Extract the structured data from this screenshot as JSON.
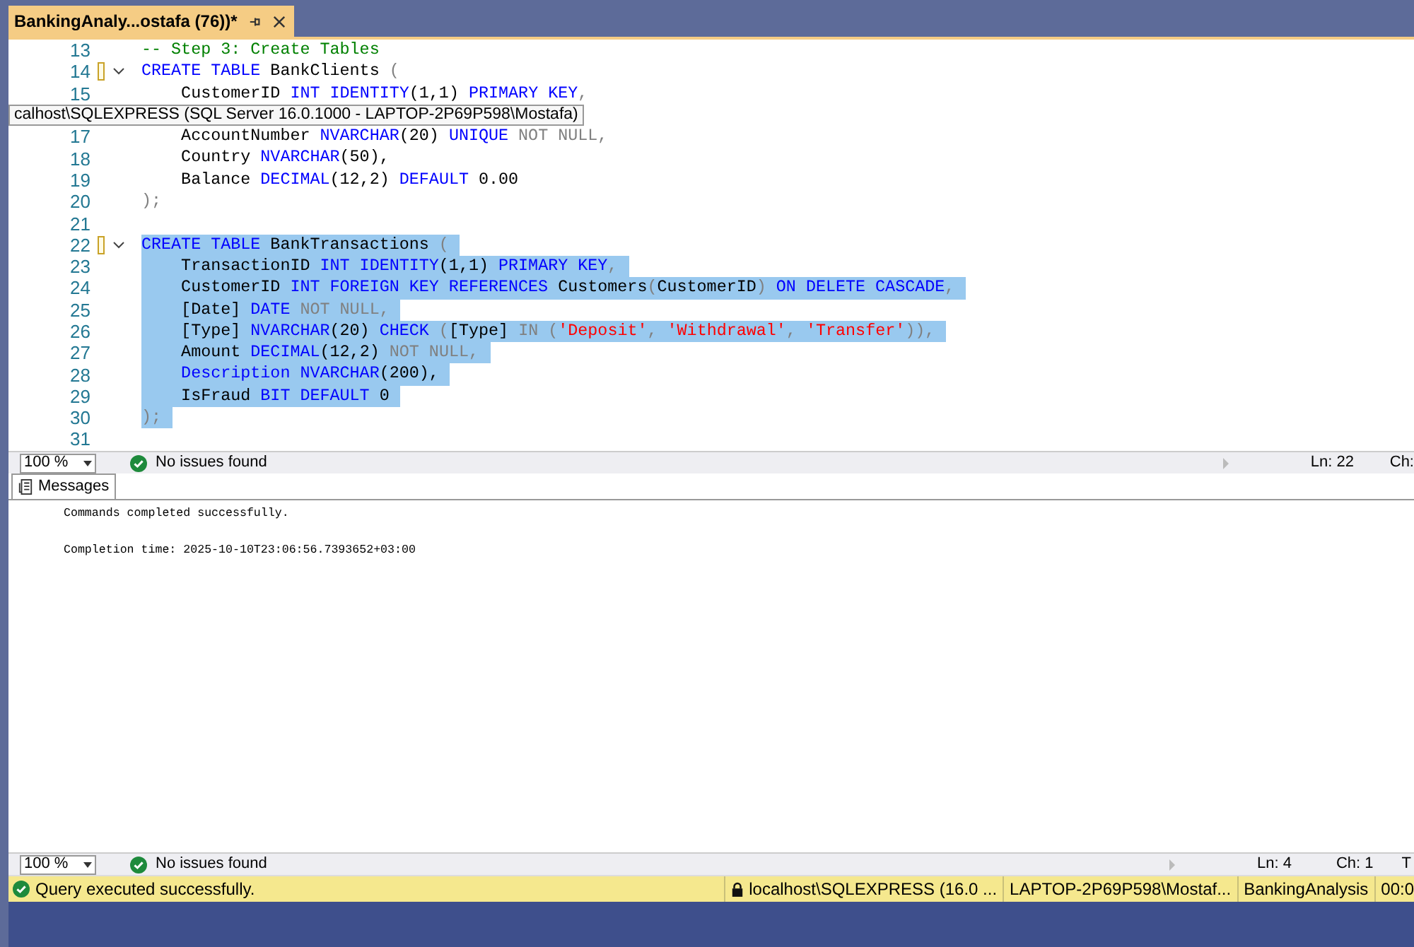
{
  "document_tab": {
    "title": "BankingAnaly...ostafa (76))*",
    "selected": true
  },
  "editor": {
    "lines": [
      {
        "number": "13",
        "selected": false,
        "tokens": [
          {
            "text": "-- Step 3: Create Tables",
            "kind": "comment"
          }
        ]
      },
      {
        "number": "14",
        "fold": true,
        "changed": true,
        "selected": false,
        "tokens": [
          {
            "text": "CREATE TABLE",
            "kind": "keyword"
          },
          {
            "text": " BankClients ",
            "kind": "plain"
          },
          {
            "text": "(",
            "kind": "operator"
          }
        ]
      },
      {
        "number": "15",
        "selected": false,
        "tokens": [
          {
            "text": "    CustomerID ",
            "kind": "plain"
          },
          {
            "text": "INT IDENTITY",
            "kind": "keyword"
          },
          {
            "text": "(1,1) ",
            "kind": "plain"
          },
          {
            "text": "PRIMARY KEY",
            "kind": "keyword"
          },
          {
            "text": ",",
            "kind": "operator"
          }
        ]
      },
      {
        "kind": "tooltip",
        "text": "calhost\\SQLEXPRESS (SQL Server 16.0.1000 - LAPTOP-2P69P598\\Mostafa)"
      },
      {
        "number": "17",
        "selected": false,
        "tokens": [
          {
            "text": "    AccountNumber ",
            "kind": "plain"
          },
          {
            "text": "NVARCHAR",
            "kind": "keyword"
          },
          {
            "text": "(20) ",
            "kind": "plain"
          },
          {
            "text": "UNIQUE",
            "kind": "keyword"
          },
          {
            "text": " NOT NULL,",
            "kind": "operator"
          }
        ]
      },
      {
        "number": "18",
        "selected": false,
        "tokens": [
          {
            "text": "    Country ",
            "kind": "plain"
          },
          {
            "text": "NVARCHAR",
            "kind": "keyword"
          },
          {
            "text": "(50),",
            "kind": "plain"
          }
        ]
      },
      {
        "number": "19",
        "selected": false,
        "tokens": [
          {
            "text": "    Balance ",
            "kind": "plain"
          },
          {
            "text": "DECIMAL",
            "kind": "keyword"
          },
          {
            "text": "(12,2) ",
            "kind": "plain"
          },
          {
            "text": "DEFAULT",
            "kind": "keyword"
          },
          {
            "text": " 0.00",
            "kind": "plain"
          }
        ]
      },
      {
        "number": "20",
        "selected": false,
        "tokens": [
          {
            "text": ");",
            "kind": "operator"
          }
        ]
      },
      {
        "number": "21"
      },
      {
        "number": "22",
        "fold": true,
        "changed": true,
        "selected": true,
        "tokens": [
          {
            "text": "CREATE TABLE",
            "kind": "keyword"
          },
          {
            "text": " BankTransactions ",
            "kind": "plain"
          },
          {
            "text": "(",
            "kind": "operator"
          }
        ]
      },
      {
        "number": "23",
        "selected": true,
        "tokens": [
          {
            "text": "    TransactionID ",
            "kind": "plain"
          },
          {
            "text": "INT IDENTITY",
            "kind": "keyword"
          },
          {
            "text": "(1,1) ",
            "kind": "plain"
          },
          {
            "text": "PRIMARY KEY",
            "kind": "keyword"
          },
          {
            "text": ",",
            "kind": "operator"
          }
        ]
      },
      {
        "number": "24",
        "selected": true,
        "tokens": [
          {
            "text": "    CustomerID ",
            "kind": "plain"
          },
          {
            "text": "INT FOREIGN KEY REFERENCES",
            "kind": "keyword"
          },
          {
            "text": " Customers",
            "kind": "plain"
          },
          {
            "text": "(",
            "kind": "operator"
          },
          {
            "text": "CustomerID",
            "kind": "plain"
          },
          {
            "text": ") ",
            "kind": "operator"
          },
          {
            "text": "ON DELETE CASCADE",
            "kind": "keyword"
          },
          {
            "text": ",",
            "kind": "operator"
          }
        ]
      },
      {
        "number": "25",
        "selected": true,
        "tokens": [
          {
            "text": "    [Date] ",
            "kind": "plain"
          },
          {
            "text": "DATE",
            "kind": "keyword"
          },
          {
            "text": " NOT NULL,",
            "kind": "operator"
          }
        ]
      },
      {
        "number": "26",
        "selected": true,
        "tokens": [
          {
            "text": "    [Type] ",
            "kind": "plain"
          },
          {
            "text": "NVARCHAR",
            "kind": "keyword"
          },
          {
            "text": "(20) ",
            "kind": "plain"
          },
          {
            "text": "CHECK",
            "kind": "keyword"
          },
          {
            "text": " (",
            "kind": "operator"
          },
          {
            "text": "[Type] ",
            "kind": "plain"
          },
          {
            "text": "IN (",
            "kind": "operator"
          },
          {
            "text": "'Deposit'",
            "kind": "string"
          },
          {
            "text": ", ",
            "kind": "operator"
          },
          {
            "text": "'Withdrawal'",
            "kind": "string"
          },
          {
            "text": ", ",
            "kind": "operator"
          },
          {
            "text": "'Transfer'",
            "kind": "string"
          },
          {
            "text": ")),",
            "kind": "operator"
          }
        ]
      },
      {
        "number": "27",
        "selected": true,
        "tokens": [
          {
            "text": "    Amount ",
            "kind": "plain"
          },
          {
            "text": "DECIMAL",
            "kind": "keyword"
          },
          {
            "text": "(12,2) ",
            "kind": "plain"
          },
          {
            "text": "NOT NULL,",
            "kind": "operator"
          }
        ]
      },
      {
        "number": "28",
        "selected": true,
        "tokens": [
          {
            "text": "    Description NVARCHAR",
            "kind": "keyword"
          },
          {
            "text": "(200),",
            "kind": "plain"
          }
        ]
      },
      {
        "number": "29",
        "selected": true,
        "tokens": [
          {
            "text": "    IsFraud ",
            "kind": "plain"
          },
          {
            "text": "BIT DEFAULT",
            "kind": "keyword"
          },
          {
            "text": " 0",
            "kind": "plain"
          }
        ]
      },
      {
        "number": "30",
        "selected": true,
        "tokens": [
          {
            "text": ");",
            "kind": "operator"
          }
        ]
      },
      {
        "number": "31"
      }
    ],
    "status": {
      "zoom": "100 %",
      "issues": "No issues found",
      "line": "Ln: 22",
      "column": "Ch:"
    }
  },
  "results": {
    "tabs": [
      {
        "label": "Messages",
        "selected": true
      }
    ],
    "messages": [
      "Commands completed successfully.",
      "Completion time: 2025-10-10T23:06:56.7393652+03:00"
    ],
    "status": {
      "zoom": "100 %",
      "issues": "No issues found",
      "line": "Ln: 4",
      "column": "Ch: 1",
      "extra": "T"
    }
  },
  "status_bar": {
    "message": "Query executed successfully.",
    "server": "localhost\\SQLEXPRESS (16.0 ...",
    "user": "LAPTOP-2P69P598\\Mostaf...",
    "database": "BankingAnalysis",
    "time": "00:0"
  }
}
